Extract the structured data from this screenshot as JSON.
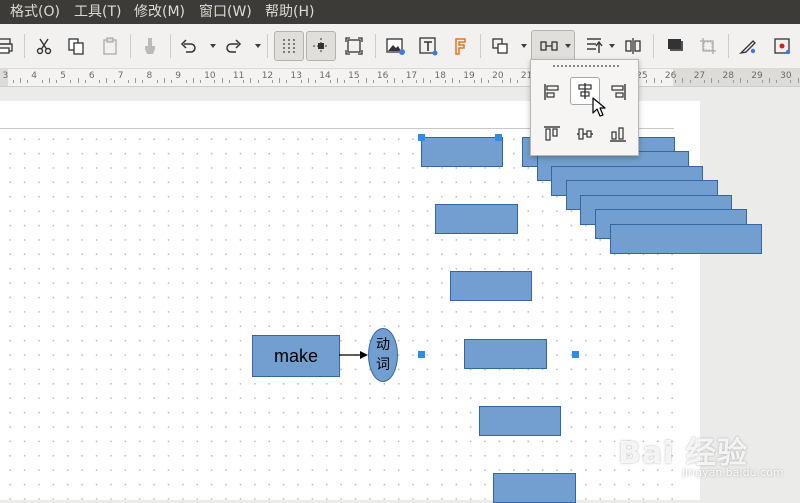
{
  "menubar": {
    "items": [
      {
        "label": "格式(O)"
      },
      {
        "label": "工具(T)"
      },
      {
        "label": "修改(M)"
      },
      {
        "label": "窗口(W)"
      },
      {
        "label": "帮助(H)"
      }
    ]
  },
  "toolbar": {
    "icons": [
      "print-icon",
      "cut-icon",
      "copy-icon",
      "paste-icon",
      "clone-formatting-icon",
      "undo-icon",
      "redo-icon",
      "grid-display-icon",
      "helplines-icon",
      "zoom-page-icon",
      "insert-image-icon",
      "insert-textbox-icon",
      "fontwork-icon",
      "transformations-icon",
      "align-objects-icon",
      "arrange-icon",
      "distribute-icon",
      "shadow-icon",
      "crop-icon",
      "points-edit-icon",
      "toggle-extrusion-icon"
    ]
  },
  "ruler": {
    "labels": [
      "3",
      "4",
      "5",
      "6",
      "7",
      "8",
      "9",
      "10",
      "11",
      "12",
      "13",
      "14",
      "15",
      "16",
      "17",
      "18",
      "19",
      "20",
      "21",
      "22",
      "23",
      "24",
      "25",
      "26",
      "27",
      "28",
      "29",
      "30"
    ]
  },
  "canvas": {
    "make_label": "make",
    "ellipse_label": "动词"
  },
  "align_popup": {
    "options": [
      "align-left-icon",
      "align-center-icon",
      "align-right-icon",
      "align-top-icon",
      "align-middle-icon",
      "align-bottom-icon"
    ],
    "selected": "align-center-icon"
  },
  "watermark": {
    "logo": "Bai 经验",
    "sub": "jingyan.baidu.com"
  },
  "colors": {
    "shape_fill": "#729fcf",
    "shape_border": "#3465a4",
    "handle": "#2f8bea",
    "menubar_bg": "#3c3b37"
  }
}
